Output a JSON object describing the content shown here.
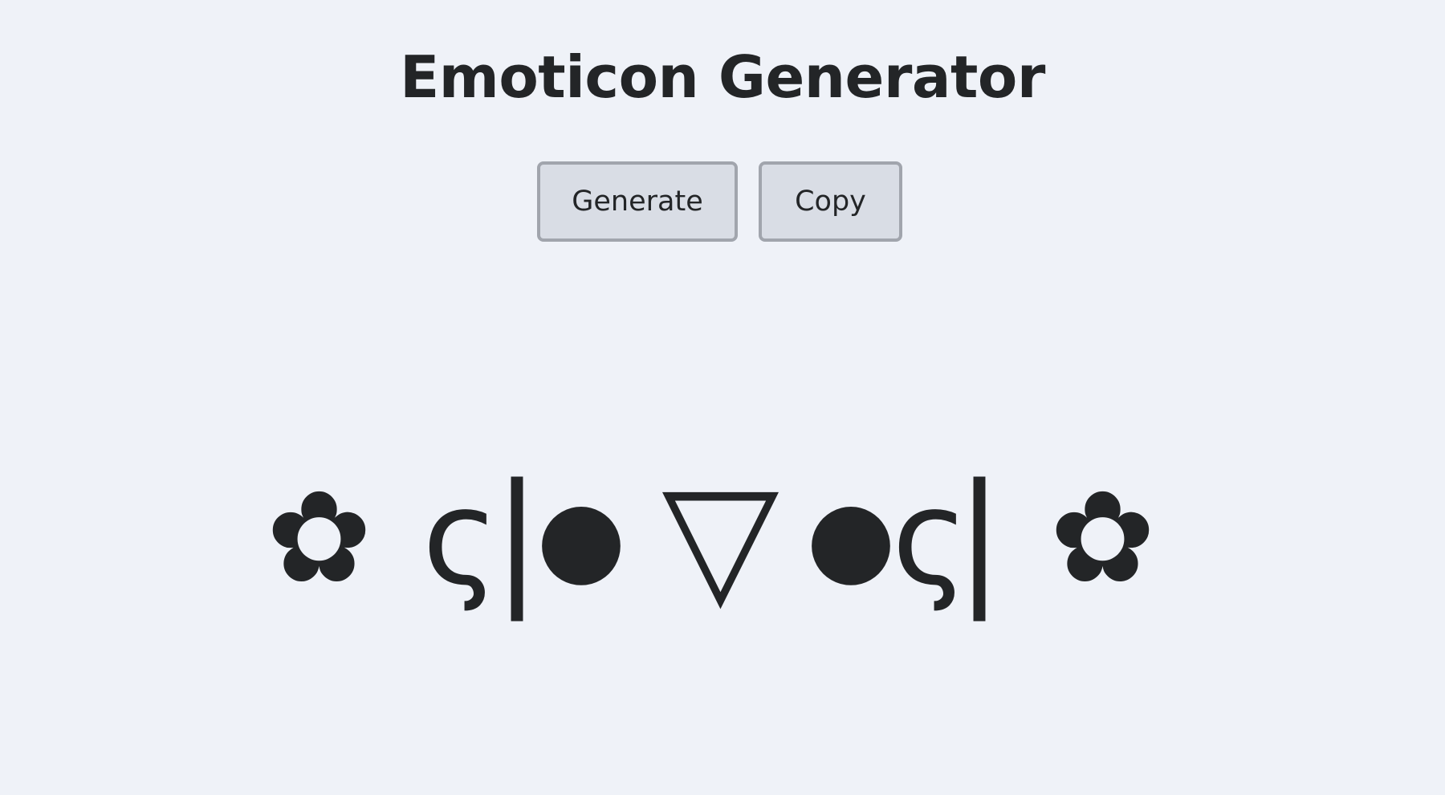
{
  "app": {
    "title": "Emoticon Generator"
  },
  "toolbar": {
    "generate_label": "Generate",
    "copy_label": "Copy"
  },
  "emoticon": {
    "glyphs": [
      {
        "char": "✿",
        "name": "left-flower-icon"
      },
      {
        "char": "ς",
        "name": "left-cheek-glyph"
      },
      {
        "char": "|",
        "name": "left-bar-glyph"
      },
      {
        "char": "●",
        "name": "left-eye-glyph"
      },
      {
        "char": "▽",
        "name": "mouth-glyph"
      },
      {
        "char": "●",
        "name": "right-eye-glyph"
      },
      {
        "char": "ς",
        "name": "right-cheek-glyph"
      },
      {
        "char": "|",
        "name": "right-bar-glyph"
      },
      {
        "char": "✿",
        "name": "right-flower-icon"
      }
    ]
  },
  "colors": {
    "background": "#eff2f8",
    "text": "#232527",
    "button_background": "#d9dde5",
    "button_border": "#a1a5ad"
  }
}
